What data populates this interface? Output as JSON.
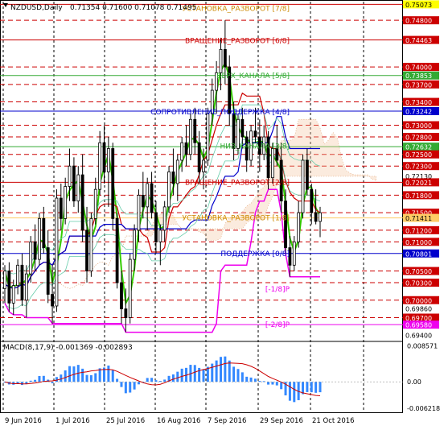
{
  "window": {
    "title": "NZDUSD,Daily",
    "ohlc": "0.71354 0.71600 0.71078 0.71495"
  },
  "levels": [
    {
      "price": "0.75073",
      "bg": "#ffff00",
      "fg": "#000000",
      "line": "#cc0000",
      "dash": "0"
    },
    {
      "price": "0.74800",
      "bg": "#cc0000",
      "fg": "#ffffff",
      "line": "#cc0000",
      "dash": "6,4"
    },
    {
      "price": "0.74463",
      "bg": "#cc0000",
      "fg": "#ffffff",
      "line": "#cc0000",
      "dash": "0"
    },
    {
      "price": "0.74000",
      "bg": "#cc0000",
      "fg": "#ffffff",
      "line": "#cc0000",
      "dash": "6,4"
    },
    {
      "price": "0.73853",
      "bg": "#33aa33",
      "fg": "#ffffff",
      "line": "#33aa33",
      "dash": "0"
    },
    {
      "price": "0.73700",
      "bg": "#cc0000",
      "fg": "#ffffff",
      "line": "#cc0000",
      "dash": "6,4"
    },
    {
      "price": "0.73400",
      "bg": "#cc0000",
      "fg": "#ffffff",
      "line": "#cc0000",
      "dash": "6,4"
    },
    {
      "price": "0.73242",
      "bg": "#0000cc",
      "fg": "#ffffff",
      "line": "#0000cc",
      "dash": "0"
    },
    {
      "price": "0.73000",
      "bg": "#cc0000",
      "fg": "#ffffff",
      "line": "#cc0000",
      "dash": "6,4"
    },
    {
      "price": "0.72800",
      "bg": "#cc0000",
      "fg": "#ffffff",
      "line": "#cc0000",
      "dash": "6,4"
    },
    {
      "price": "0.72632",
      "bg": "#33aa33",
      "fg": "#ffffff",
      "line": "#33aa33",
      "dash": "0"
    },
    {
      "price": "0.72500",
      "bg": "#cc0000",
      "fg": "#ffffff",
      "line": "#cc0000",
      "dash": "6,4"
    },
    {
      "price": "0.72300",
      "bg": "#cc0000",
      "fg": "#ffffff",
      "line": "#cc0000",
      "dash": "6,4"
    },
    {
      "price": "0.72130",
      "bg": "#ffffff",
      "fg": "#000000",
      "line": "",
      "dash": "0"
    },
    {
      "price": "0.72021",
      "bg": "#cc0000",
      "fg": "#ffffff",
      "line": "#cc0000",
      "dash": "0"
    },
    {
      "price": "0.71800",
      "bg": "#cc0000",
      "fg": "#ffffff",
      "line": "#cc0000",
      "dash": "6,4"
    },
    {
      "price": "0.71500",
      "bg": "#cc0000",
      "fg": "#ffffff",
      "line": "#cc0000",
      "dash": "6,4"
    },
    {
      "price": "0.71411",
      "bg": "#ffcc66",
      "fg": "#000000",
      "line": "#ffcc66",
      "dash": "0"
    },
    {
      "price": "0.71200",
      "bg": "#cc0000",
      "fg": "#ffffff",
      "line": "#cc0000",
      "dash": "6,4"
    },
    {
      "price": "0.71000",
      "bg": "#cc0000",
      "fg": "#ffffff",
      "line": "#cc0000",
      "dash": "6,4"
    },
    {
      "price": "0.70801",
      "bg": "#0000cc",
      "fg": "#ffffff",
      "line": "#0000cc",
      "dash": "0"
    },
    {
      "price": "0.70500",
      "bg": "#cc0000",
      "fg": "#ffffff",
      "line": "#cc0000",
      "dash": "6,4"
    },
    {
      "price": "0.70300",
      "bg": "#cc0000",
      "fg": "#ffffff",
      "line": "#cc0000",
      "dash": "6,4"
    },
    {
      "price": "0.70000",
      "bg": "#cc0000",
      "fg": "#ffffff",
      "line": "#cc0000",
      "dash": "6,4"
    },
    {
      "price": "0.69860",
      "bg": "#ffffff",
      "fg": "#000000",
      "line": "",
      "dash": "0"
    },
    {
      "price": "0.69700",
      "bg": "#cc0000",
      "fg": "#ffffff",
      "line": "#cc0000",
      "dash": "6,4"
    },
    {
      "price": "0.69580",
      "bg": "#ee00ee",
      "fg": "#ffffff",
      "line": "#ee00ee",
      "dash": "0"
    },
    {
      "price": "0.69400",
      "bg": "#ffffff",
      "fg": "#000000",
      "line": "",
      "dash": "0"
    }
  ],
  "murrey_labels": [
    {
      "text": "УСТАНОВКА_РАЗВОРОТ [7/8]",
      "color": "#cc8800",
      "price": 0.75
    },
    {
      "text": "ВРАЩЕНИЕ_РАЗВОРОТ [6/8]",
      "color": "#cc0000",
      "price": 0.7445
    },
    {
      "text": "ВЕРХ_КАНАЛА [5/8]",
      "color": "#33aa33",
      "price": 0.7385
    },
    {
      "text": "СОПРОТИВЛЕНИЕ_ПОДДЕРЖКА [4/8]",
      "color": "#0000cc",
      "price": 0.7323
    },
    {
      "text": "НИЗ_КАНАЛА [3/8]",
      "color": "#33aa33",
      "price": 0.7264
    },
    {
      "text": "ВРАЩЕНИЕ_РАЗВОРОТ [2/8]",
      "color": "#cc0000",
      "price": 0.7202
    },
    {
      "text": "УСТАНОВКА_РАЗВОРОТ [1/8]",
      "color": "#cc8800",
      "price": 0.7141
    },
    {
      "text": "ПОДДЕРЖКА [0/8]",
      "color": "#0000cc",
      "price": 0.708
    },
    {
      "text": "[-1/8]P",
      "color": "#ee00ee",
      "price": 0.7019
    },
    {
      "text": "[-2/8]P",
      "color": "#ee00ee",
      "price": 0.6958
    }
  ],
  "macd": {
    "label": "MACD(8,17,9) -0.001369 -0.002893",
    "axis": [
      "0.008571",
      "0.00",
      "-0.006218"
    ]
  },
  "dates": [
    "9 Jun 2016",
    "1 Jul 2016",
    "25 Jul 2016",
    "16 Aug 2016",
    "7 Sep 2016",
    "29 Sep 2016",
    "21 Oct 2016"
  ],
  "chart_data": {
    "type": "candlestick",
    "symbol": "NZDUSD",
    "timeframe": "Daily",
    "price_range": [
      0.6932,
      0.7512
    ],
    "macd_range": [
      -0.0072,
      0.009
    ],
    "candles": [
      [
        0.702,
        0.706,
        0.6995,
        0.705
      ],
      [
        0.705,
        0.7065,
        0.698,
        0.6995
      ],
      [
        0.6995,
        0.7035,
        0.6975,
        0.7025
      ],
      [
        0.7025,
        0.707,
        0.701,
        0.706
      ],
      [
        0.706,
        0.708,
        0.699,
        0.7
      ],
      [
        0.7,
        0.706,
        0.697,
        0.7045
      ],
      [
        0.7045,
        0.711,
        0.703,
        0.71
      ],
      [
        0.71,
        0.713,
        0.705,
        0.707
      ],
      [
        0.707,
        0.715,
        0.706,
        0.714
      ],
      [
        0.714,
        0.716,
        0.708,
        0.709
      ],
      [
        0.709,
        0.712,
        0.6995,
        0.701
      ],
      [
        0.701,
        0.706,
        0.696,
        0.699
      ],
      [
        0.699,
        0.719,
        0.698,
        0.7175
      ],
      [
        0.7175,
        0.72,
        0.712,
        0.714
      ],
      [
        0.714,
        0.721,
        0.713,
        0.7195
      ],
      [
        0.7195,
        0.726,
        0.717,
        0.723
      ],
      [
        0.723,
        0.7245,
        0.716,
        0.717
      ],
      [
        0.717,
        0.723,
        0.715,
        0.7215
      ],
      [
        0.7215,
        0.725,
        0.71,
        0.712
      ],
      [
        0.712,
        0.716,
        0.703,
        0.705
      ],
      [
        0.705,
        0.715,
        0.704,
        0.714
      ],
      [
        0.714,
        0.721,
        0.713,
        0.719
      ],
      [
        0.719,
        0.729,
        0.718,
        0.727
      ],
      [
        0.727,
        0.73,
        0.72,
        0.722
      ],
      [
        0.722,
        0.728,
        0.716,
        0.726
      ],
      [
        0.726,
        0.727,
        0.712,
        0.714
      ],
      [
        0.714,
        0.715,
        0.702,
        0.703
      ],
      [
        0.703,
        0.705,
        0.696,
        0.6985
      ],
      [
        0.6985,
        0.702,
        0.6945,
        0.697
      ],
      [
        0.697,
        0.708,
        0.696,
        0.707
      ],
      [
        0.707,
        0.713,
        0.705,
        0.712
      ],
      [
        0.712,
        0.719,
        0.71,
        0.718
      ],
      [
        0.718,
        0.722,
        0.714,
        0.716
      ],
      [
        0.716,
        0.721,
        0.712,
        0.72
      ],
      [
        0.72,
        0.722,
        0.714,
        0.715
      ],
      [
        0.715,
        0.717,
        0.708,
        0.71
      ],
      [
        0.71,
        0.713,
        0.706,
        0.712
      ],
      [
        0.712,
        0.717,
        0.71,
        0.716
      ],
      [
        0.716,
        0.723,
        0.715,
        0.722
      ],
      [
        0.722,
        0.726,
        0.718,
        0.72
      ],
      [
        0.72,
        0.725,
        0.717,
        0.724
      ],
      [
        0.724,
        0.728,
        0.722,
        0.727
      ],
      [
        0.727,
        0.73,
        0.723,
        0.725
      ],
      [
        0.725,
        0.732,
        0.724,
        0.731
      ],
      [
        0.731,
        0.733,
        0.725,
        0.727
      ],
      [
        0.727,
        0.729,
        0.72,
        0.722
      ],
      [
        0.722,
        0.726,
        0.719,
        0.724
      ],
      [
        0.724,
        0.733,
        0.723,
        0.732
      ],
      [
        0.732,
        0.738,
        0.73,
        0.736
      ],
      [
        0.736,
        0.741,
        0.732,
        0.739
      ],
      [
        0.739,
        0.745,
        0.736,
        0.743
      ],
      [
        0.743,
        0.748,
        0.737,
        0.74
      ],
      [
        0.74,
        0.742,
        0.73,
        0.732
      ],
      [
        0.732,
        0.734,
        0.724,
        0.726
      ],
      [
        0.726,
        0.732,
        0.725,
        0.731
      ],
      [
        0.731,
        0.733,
        0.726,
        0.728
      ],
      [
        0.728,
        0.729,
        0.722,
        0.724
      ],
      [
        0.724,
        0.73,
        0.723,
        0.729
      ],
      [
        0.729,
        0.733,
        0.727,
        0.728
      ],
      [
        0.728,
        0.731,
        0.722,
        0.725
      ],
      [
        0.725,
        0.73,
        0.724,
        0.728
      ],
      [
        0.728,
        0.729,
        0.719,
        0.721
      ],
      [
        0.721,
        0.727,
        0.72,
        0.726
      ],
      [
        0.726,
        0.73,
        0.723,
        0.724
      ],
      [
        0.724,
        0.727,
        0.715,
        0.717
      ],
      [
        0.717,
        0.719,
        0.708,
        0.709
      ],
      [
        0.709,
        0.711,
        0.704,
        0.706
      ],
      [
        0.706,
        0.711,
        0.705,
        0.71
      ],
      [
        0.71,
        0.717,
        0.709,
        0.715
      ],
      [
        0.715,
        0.725,
        0.714,
        0.724
      ],
      [
        0.724,
        0.726,
        0.718,
        0.719
      ],
      [
        0.719,
        0.72,
        0.713,
        0.715
      ],
      [
        0.715,
        0.719,
        0.713,
        0.7135
      ],
      [
        0.7135,
        0.716,
        0.7108,
        0.715
      ]
    ]
  }
}
